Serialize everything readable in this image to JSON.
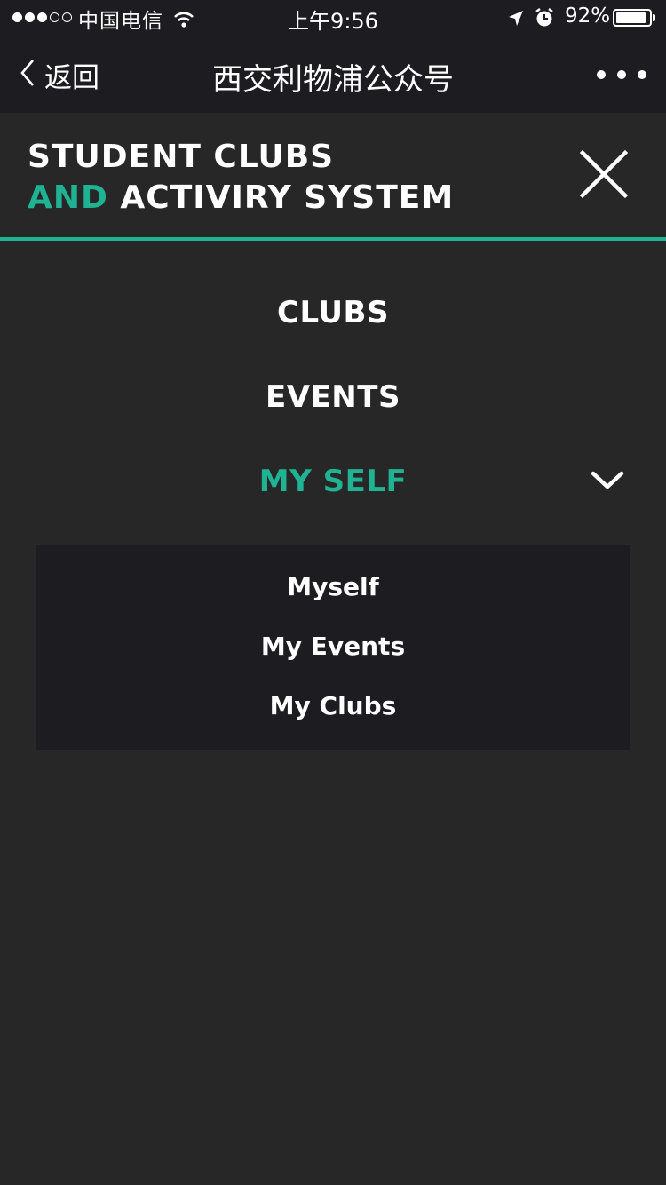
{
  "status_bar": {
    "carrier": "中国电信",
    "time": "上午9:56",
    "battery_percent": "92%",
    "battery_level": 0.92,
    "signal_filled": 3,
    "signal_total": 5
  },
  "nav_bar": {
    "back_label": "返回",
    "title": "西交利物浦公众号"
  },
  "brand": {
    "line1": "STUDENT CLUBS",
    "line2_accent": "AND",
    "line2_rest": "ACTIVIRY SYSTEM"
  },
  "menu": {
    "clubs": "CLUBS",
    "events": "EVENTS",
    "myself": "MY SELF"
  },
  "submenu": {
    "items": [
      "Myself",
      "My Events",
      "My Clubs"
    ]
  },
  "colors": {
    "accent": "#1fb393",
    "background": "#272727",
    "bar_background": "#1d1c21",
    "text": "#ffffff"
  }
}
